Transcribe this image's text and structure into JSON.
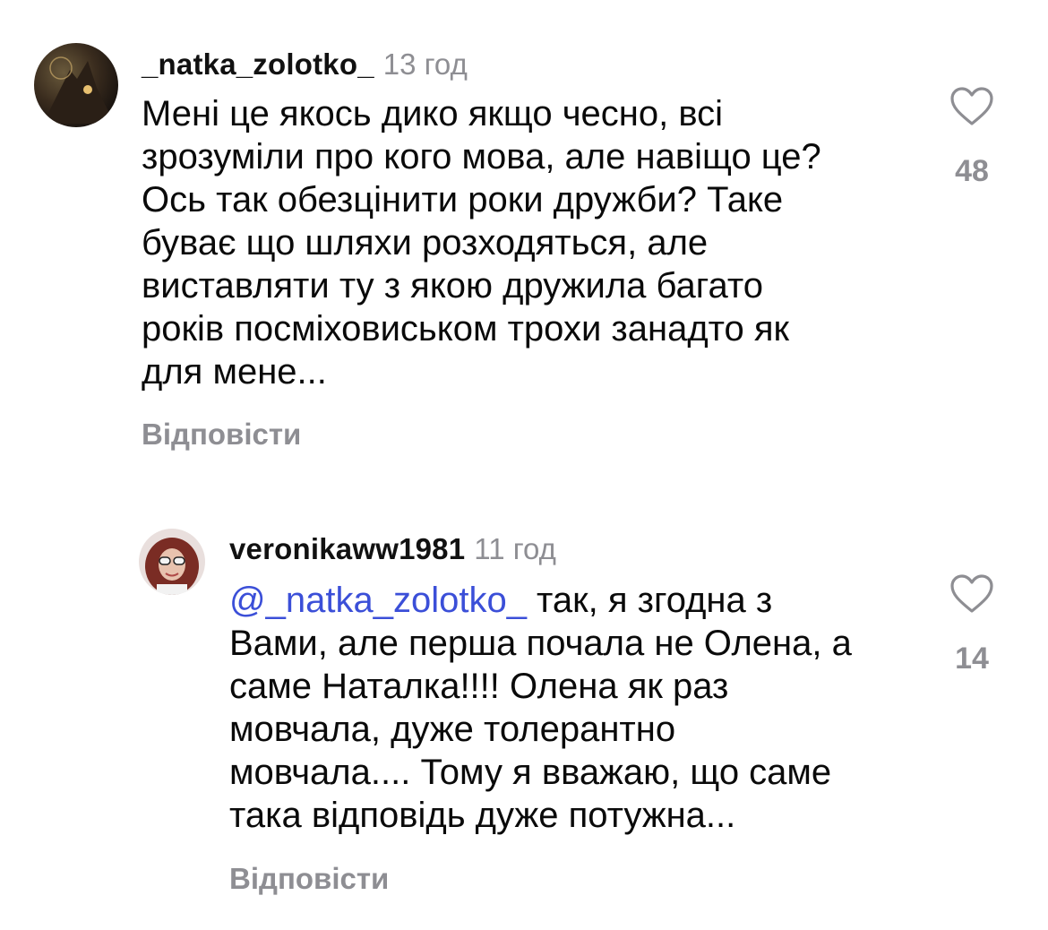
{
  "comments": [
    {
      "username": "_natka_zolotko_",
      "time": "13 год",
      "lines": [
        "Мені це якось дико якщо чесно, всі",
        "зрозуміли про кого мова, але навіщо це?",
        "Ось так обезцінити роки дружби? Таке",
        "буває що шляхи розходяться, але",
        "виставляти ту з якою дружила багато",
        "років посміховиськом трохи занадто як",
        "для мене..."
      ],
      "reply_label": "Відповісти",
      "likes": "48"
    },
    {
      "username": "veronikaww1981",
      "time": "11 год",
      "mention": "@_natka_zolotko_",
      "first_line_rest": " так, я згодна з",
      "lines": [
        "Вами, але перша почала не Олена, а",
        "саме Наталка!!!! Олена як раз",
        "мовчала, дуже толерантно",
        "мовчала.... Тому я вважаю, що саме",
        "така відповідь дуже потужна..."
      ],
      "reply_label": "Відповісти",
      "likes": "14"
    }
  ],
  "colors": {
    "mention": "#3b4fd8",
    "secondary_text": "#8e8e93"
  },
  "icons": {
    "like": "heart-outline-icon"
  }
}
